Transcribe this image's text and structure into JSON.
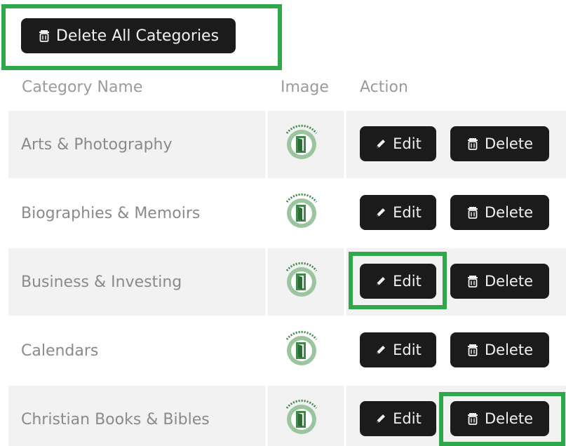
{
  "toolbar": {
    "delete_all_label": "Delete All Categories",
    "delete_all_icon": "trash-icon"
  },
  "table": {
    "headers": [
      "Category Name",
      "Image",
      "Action"
    ],
    "rows": [
      {
        "name": "Arts & Photography",
        "image_alt": "No image available",
        "edit_label": "Edit",
        "delete_label": "Delete"
      },
      {
        "name": "Biographies & Memoirs",
        "image_alt": "No image available",
        "edit_label": "Edit",
        "delete_label": "Delete"
      },
      {
        "name": "Business & Investing",
        "image_alt": "No image available",
        "edit_label": "Edit",
        "delete_label": "Delete"
      },
      {
        "name": "Calendars",
        "image_alt": "No image available",
        "edit_label": "Edit",
        "delete_label": "Delete"
      },
      {
        "name": "Christian Books & Bibles",
        "image_alt": "No image available",
        "edit_label": "Edit",
        "delete_label": "Delete"
      }
    ]
  },
  "colors": {
    "button_bg": "#1b1b1b",
    "button_text": "#f2f2f2",
    "highlight": "#2ea84a",
    "row_shade": "#f2f2f2",
    "text_muted": "#8a8a8a"
  }
}
